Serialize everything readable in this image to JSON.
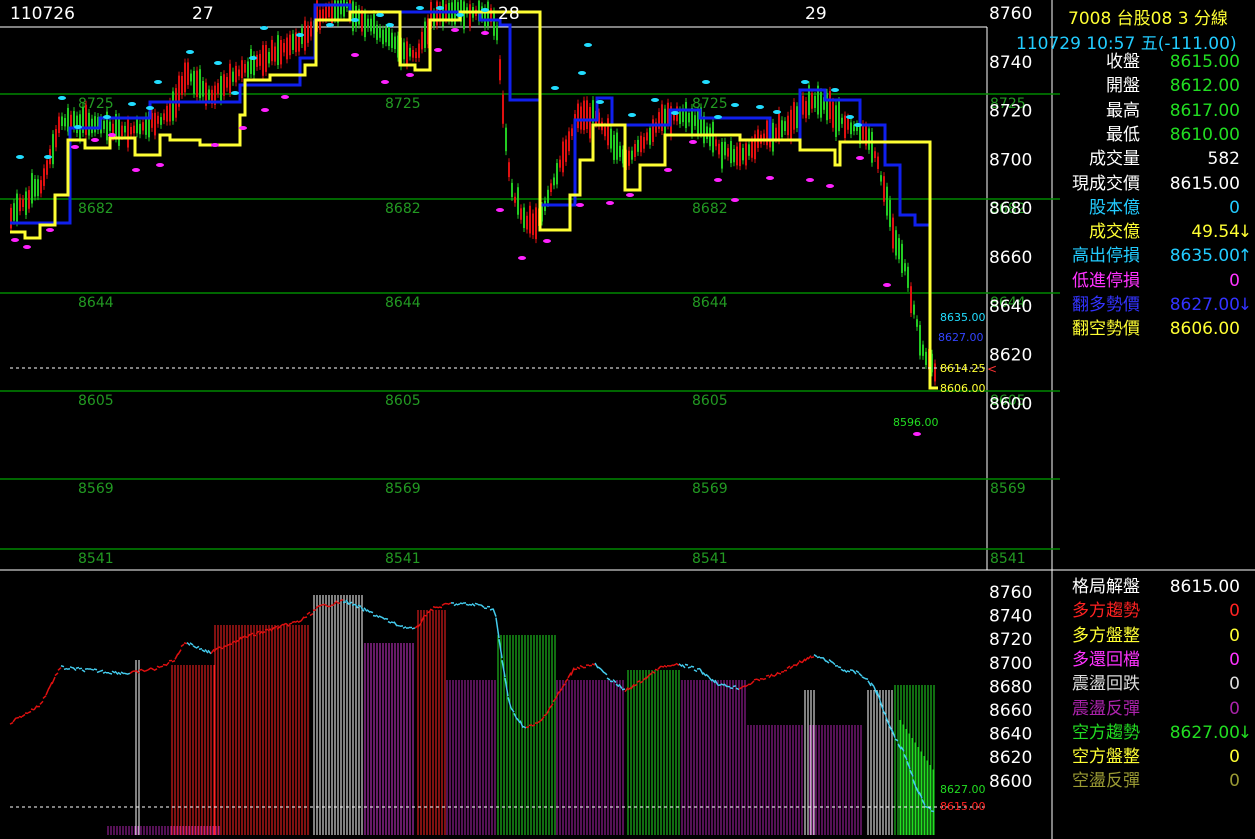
{
  "header": {
    "symbol_line": "7008  台股08 3 分線",
    "datetime_line": "110729 10:57 五(-111.00)",
    "date_labels": [
      "110726",
      "27",
      "28",
      "29"
    ]
  },
  "info_panel": [
    {
      "label": "收盤",
      "value": "8615.00",
      "label_color": "#ffffff",
      "value_color": "#22dd22",
      "arrow": ""
    },
    {
      "label": "開盤",
      "value": "8612.00",
      "label_color": "#ffffff",
      "value_color": "#22dd22",
      "arrow": ""
    },
    {
      "label": "最高",
      "value": "8617.00",
      "label_color": "#ffffff",
      "value_color": "#22dd22",
      "arrow": ""
    },
    {
      "label": "最低",
      "value": "8610.00",
      "label_color": "#ffffff",
      "value_color": "#22dd22",
      "arrow": ""
    },
    {
      "label": "成交量",
      "value": "582",
      "label_color": "#ffffff",
      "value_color": "#ffffff",
      "arrow": ""
    },
    {
      "label": "現成交價",
      "value": "8615.00",
      "label_color": "#ffffff",
      "value_color": "#ffffff",
      "arrow": ""
    },
    {
      "label": "股本億",
      "value": "0",
      "label_color": "#22ccff",
      "value_color": "#22ccff",
      "arrow": ""
    },
    {
      "label": "成交億",
      "value": "49.54",
      "label_color": "#ffff33",
      "value_color": "#ffff33",
      "arrow": "↓",
      "arrow_color": "#ffff33"
    },
    {
      "label": "高出停損",
      "value": "8635.00",
      "label_color": "#22ccff",
      "value_color": "#22ccff",
      "arrow": "↑",
      "arrow_color": "#22ccff"
    },
    {
      "label": "低進停損",
      "value": "0",
      "label_color": "#ff33ff",
      "value_color": "#ff33ff",
      "arrow": ""
    },
    {
      "label": "翻多勢價",
      "value": "8627.00",
      "label_color": "#3333ff",
      "value_color": "#3333ff",
      "arrow": "↓",
      "arrow_color": "#3333ff"
    },
    {
      "label": "翻空勢價",
      "value": "8606.00",
      "label_color": "#ffff33",
      "value_color": "#ffff33",
      "arrow": ""
    }
  ],
  "pattern_panel": [
    {
      "label": "格局解盤",
      "value": "8615.00",
      "label_color": "#ffffff",
      "value_color": "#ffffff",
      "arrow": ""
    },
    {
      "label": "多方趨勢",
      "value": "0",
      "label_color": "#ff2222",
      "value_color": "#ff2222",
      "arrow": ""
    },
    {
      "label": "多方盤整",
      "value": "0",
      "label_color": "#ffff33",
      "value_color": "#ffff33",
      "arrow": ""
    },
    {
      "label": "多還回檔",
      "value": "0",
      "label_color": "#ff33ff",
      "value_color": "#ff33ff",
      "arrow": ""
    },
    {
      "label": "震盪回跌",
      "value": "0",
      "label_color": "#dddddd",
      "value_color": "#dddddd",
      "arrow": ""
    },
    {
      "label": "震盪反彈",
      "value": "0",
      "label_color": "#aa22aa",
      "value_color": "#aa22aa",
      "arrow": ""
    },
    {
      "label": "空方趨勢",
      "value": "8627.00",
      "label_color": "#22dd22",
      "value_color": "#22dd22",
      "arrow": "↓",
      "arrow_color": "#22dd22"
    },
    {
      "label": "空方盤整",
      "value": "0",
      "label_color": "#ffff33",
      "value_color": "#ffff33",
      "arrow": ""
    },
    {
      "label": "空盪反彈",
      "value": "0",
      "label_color": "#999933",
      "value_color": "#999933",
      "arrow": ""
    }
  ],
  "top_price_axis": [
    "8760",
    "8740",
    "8720",
    "8700",
    "8680",
    "8660",
    "8640",
    "8620",
    "8600"
  ],
  "bottom_price_axis": [
    "8760",
    "8740",
    "8720",
    "8700",
    "8680",
    "8660",
    "8640",
    "8620",
    "8600"
  ],
  "level_lines": [
    8725,
    8682,
    8644,
    8605,
    8569,
    8541
  ],
  "level_labels": [
    "8725",
    "8682",
    "8644",
    "8605",
    "8569",
    "8541"
  ],
  "marker_labels": {
    "stop_high": "8635.00",
    "long_trend": "8627.00",
    "current": "8614.25",
    "short_trend": "8606.00",
    "low": "8596.00",
    "bottom_long": "8627.00",
    "bottom_current": "8615.00"
  },
  "colors": {
    "up": "#e01010",
    "down": "#22cc22",
    "blue_line": "#1020ee",
    "yellow_line": "#ffff33",
    "cyan_dot": "#22ddff",
    "magenta_dot": "#ff22ff",
    "level_line": "#008800"
  }
}
